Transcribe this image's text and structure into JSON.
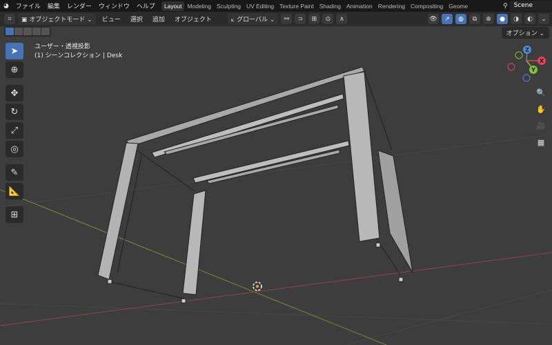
{
  "topbar": {
    "menus": [
      "ファイル",
      "編集",
      "レンダー",
      "ウィンドウ",
      "ヘルプ"
    ],
    "workspaces": [
      "Layout",
      "Modeling",
      "Sculpting",
      "UV Editing",
      "Texture Paint",
      "Shading",
      "Animation",
      "Rendering",
      "Compositing",
      "Geome"
    ],
    "active_workspace": "Layout",
    "scene": "Scene"
  },
  "header": {
    "mode": "オブジェクトモード",
    "menus": [
      "ビュー",
      "選択",
      "追加",
      "オブジェクト"
    ],
    "orientation": "グローバル",
    "options": "オプション"
  },
  "viewport": {
    "view_label": "ユーザー・透視投影",
    "collection_label": "(1) シーンコレクション | Desk"
  },
  "gizmo": {
    "axes": [
      "X",
      "Y",
      "Z"
    ]
  },
  "colors": {
    "accent": "#4772b3",
    "x_axis": "#e8425b",
    "y_axis": "#7ec236",
    "z_axis": "#4d8bdb",
    "background": "#3d3d3d"
  }
}
